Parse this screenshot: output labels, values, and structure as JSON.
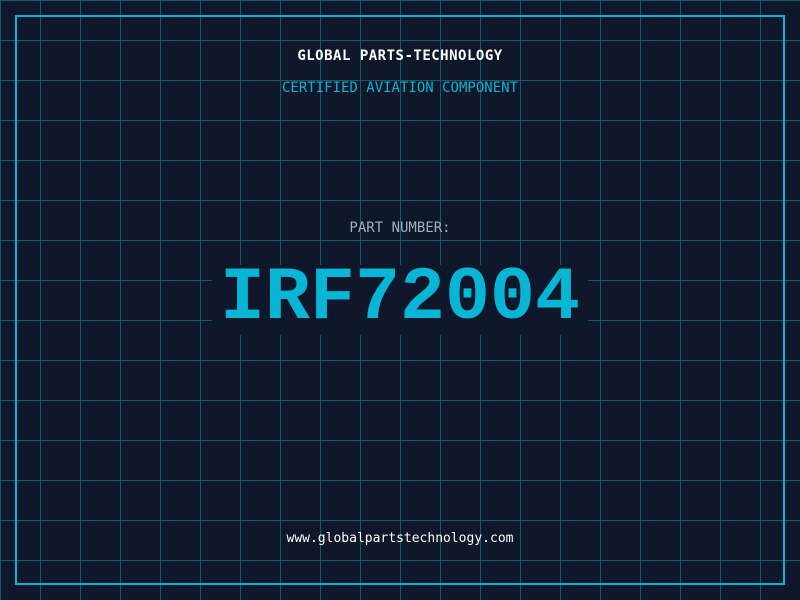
{
  "colors": {
    "background": "#0f172a",
    "grid": "#0e5a70",
    "accent": "#06b6d4"
  },
  "header": {
    "title": "GLOBAL PARTS-TECHNOLOGY",
    "subtitle": "CERTIFIED AVIATION COMPONENT"
  },
  "part": {
    "label": "PART NUMBER:",
    "number": "IRF72004"
  },
  "footer": {
    "url": "www.globalpartstechnology.com"
  }
}
